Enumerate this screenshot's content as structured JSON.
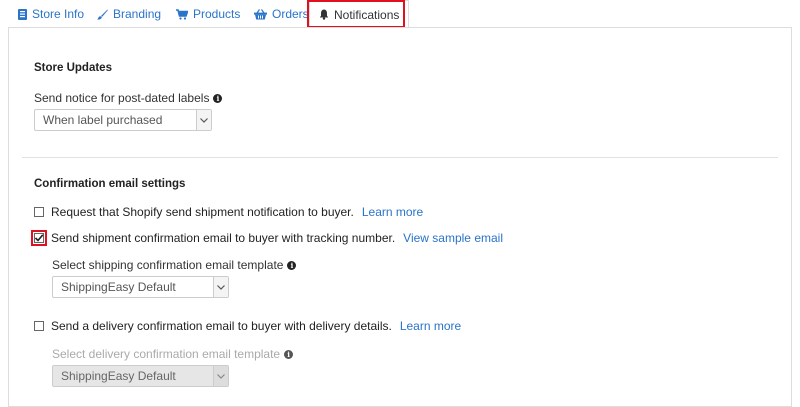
{
  "tabs": [
    {
      "label": "Store Info",
      "icon": "store-info-icon"
    },
    {
      "label": "Branding",
      "icon": "brush-icon"
    },
    {
      "label": "Products",
      "icon": "cart-icon"
    },
    {
      "label": "Orders",
      "icon": "basket-icon"
    },
    {
      "label": "Notifications",
      "icon": "bell-icon",
      "active": true
    }
  ],
  "store_updates": {
    "heading": "Store Updates",
    "notice_label": "Send notice for post-dated labels",
    "notice_value": "When label purchased"
  },
  "confirmation": {
    "heading": "Confirmation email settings",
    "shopify": {
      "label": "Request that Shopify send shipment notification to buyer.",
      "link": "Learn more",
      "checked": false
    },
    "shipment": {
      "label": "Send shipment confirmation email to buyer with tracking number.",
      "link": "View sample email",
      "checked": true
    },
    "shipment_template_label": "Select shipping confirmation email template",
    "shipment_template_value": "ShippingEasy Default",
    "delivery": {
      "label": "Send a delivery confirmation email to buyer with delivery details.",
      "link": "Learn more",
      "checked": false
    },
    "delivery_template_label": "Select delivery confirmation email template",
    "delivery_template_value": "ShippingEasy Default"
  },
  "colors": {
    "link": "#2a74c9",
    "highlight": "#e0101f"
  }
}
